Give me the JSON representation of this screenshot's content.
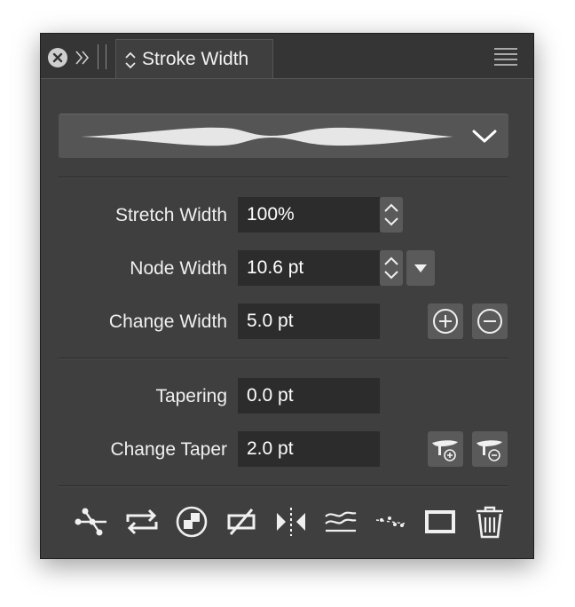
{
  "panel": {
    "tab_title": "Stroke Width"
  },
  "icons": {
    "close": "close-icon",
    "collapse": "double-chevron-right-icon",
    "grip": "drag-grip-icon",
    "tab_updown": "updown-arrows-icon",
    "menu": "hamburger-menu-icon",
    "profile_dropdown": "chevron-down-icon"
  },
  "scaling": {
    "stretch_width_label": "Stretch Width",
    "stretch_width_value": "100%",
    "node_width_label": "Node Width",
    "node_width_value": "10.6 pt",
    "change_width_label": "Change Width",
    "change_width_value": "5.0 pt"
  },
  "tapering": {
    "tapering_label": "Tapering",
    "tapering_value": "0.0 pt",
    "change_taper_label": "Change Taper",
    "change_taper_value": "2.0 pt"
  },
  "toolbar": [
    {
      "icon": "split-path-icon"
    },
    {
      "icon": "reverse-direction-icon"
    },
    {
      "icon": "join-paths-icon"
    },
    {
      "icon": "no-overlap-icon"
    },
    {
      "icon": "mirror-icon"
    },
    {
      "icon": "smooth-width-icon"
    },
    {
      "icon": "width-points-icon"
    },
    {
      "icon": "outline-rectangle-icon"
    },
    {
      "icon": "trash-icon"
    }
  ],
  "colors": {
    "panel_bg": "#3f3f3f",
    "field_bg": "#2c2c2c",
    "button_bg": "#5a5a5a",
    "text": "#f0f0f0"
  }
}
